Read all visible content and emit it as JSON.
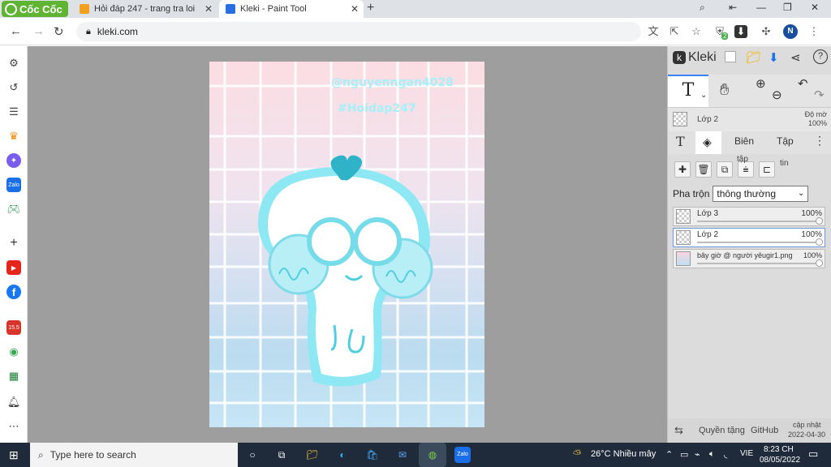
{
  "browser": {
    "brand": "Cốc Cốc",
    "tabs": [
      {
        "title": "Hỏi đáp 247 - trang tra loi"
      },
      {
        "title": "Kleki - Paint Tool"
      }
    ],
    "address": "kleki.com",
    "profile_initial": "N",
    "ext_badge": "2"
  },
  "sidebar": {
    "items": [
      "gear-icon",
      "history-icon",
      "notes-icon",
      "crown-icon",
      "messenger-icon",
      "zalo-icon",
      "game-icon",
      "plus-icon",
      "youtube-icon",
      "facebook-icon",
      "calendar-icon",
      "chrome-icon",
      "sheets-icon",
      "bell-icon",
      "more-icon"
    ],
    "zalo_label": "Zalo",
    "calendar_label": "15.5"
  },
  "canvas": {
    "handle_line1": "@nguyenngan4028",
    "handle_line2": "#Hoidap247"
  },
  "kleki": {
    "title": "Kleki",
    "layer_header": {
      "name": "Lớp 2",
      "opacity_label": "Độ mờ",
      "opacity_value": "100%"
    },
    "subtabs": {
      "edit": "Biên",
      "file": "Tập"
    },
    "action_label_1": "tập",
    "action_label_2": "tin",
    "blend_label": "Pha trộn",
    "blend_value": "thông thường",
    "layers": [
      {
        "name": "Lớp 3",
        "opacity": "100%",
        "selected": false
      },
      {
        "name": "Lớp 2",
        "opacity": "100%",
        "selected": true
      },
      {
        "name": "bây giờ @ người yêugir1.png",
        "opacity": "100%",
        "selected": false
      }
    ],
    "footer": {
      "privacy": "Quyền tặng",
      "github": "GitHub",
      "update": "cập nhật",
      "date": "2022-04-30"
    }
  },
  "taskbar": {
    "search_placeholder": "Type here to search",
    "weather": "26°C  Nhiều mây",
    "lang": "VIE",
    "time": "8:23 CH",
    "date": "08/05/2022",
    "zalo_label": "Zalo"
  },
  "colors": {
    "browser_green": "#5fb434",
    "accent_blue": "#3c82f6",
    "taskbar": "#1f2b3a",
    "workspace_gray": "#9e9e9e",
    "panel_gray": "#dcdcdc",
    "art_cyan": "#8ee8f4"
  }
}
